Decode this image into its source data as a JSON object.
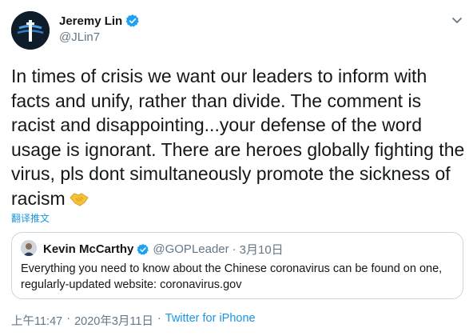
{
  "author": {
    "display_name": "Jeremy Lin",
    "handle": "@JLin7",
    "verified": true,
    "avatar_icon": "logo-avatar-icon"
  },
  "tweet": {
    "text": "In times of crisis we want our leaders to inform with facts and unify, rather than divide. The comment is racist and disappointing...your defense of the word usage is ignorant. There are heroes globally fighting the virus, pls dont simultaneously promote the sickness of racism",
    "emoji": "handshake-emoji",
    "translate_label": "翻译推文"
  },
  "quoted": {
    "display_name": "Kevin McCarthy",
    "handle": "@GOPLeader",
    "separator": "·",
    "date": "3月10日",
    "verified": true,
    "text": "Everything you need to know about the Chinese coronavirus can be found on one, regularly-updated website: coronavirus.gov"
  },
  "meta": {
    "time": "上午11:47",
    "sep1": "·",
    "date": "2020年3月11日",
    "sep2": "·",
    "source": "Twitter for iPhone"
  },
  "colors": {
    "link": "#1b95e0",
    "secondary": "#657786",
    "verified": "#1da1f2",
    "border": "#ccd6dd"
  }
}
